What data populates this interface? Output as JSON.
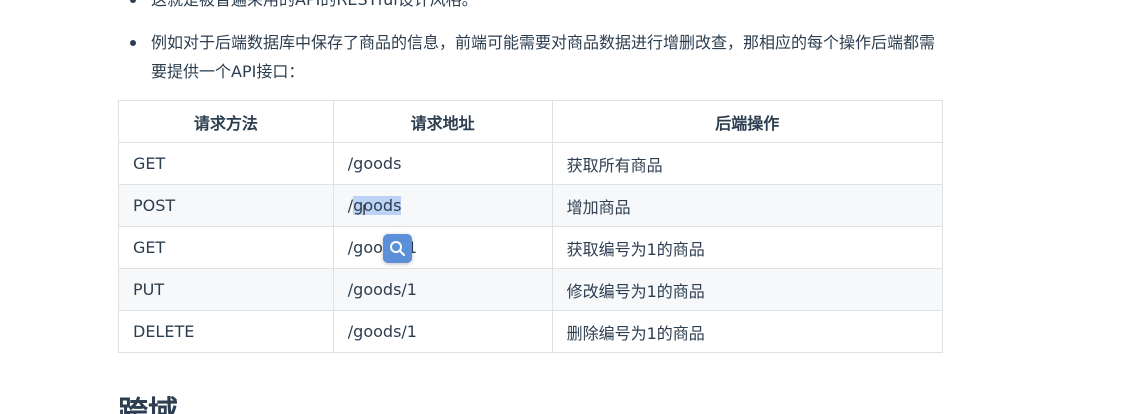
{
  "bullets": [
    "这就是被普遍采用的API的RESTful设计风格。",
    "例如对于后端数据库中保存了商品的信息，前端可能需要对商品数据进行增删改查，那相应的每个操作后端都需要提供一个API接口："
  ],
  "table": {
    "headers": [
      "请求方法",
      "请求地址",
      "后端操作"
    ],
    "rows": [
      [
        "GET",
        "/goods",
        "获取所有商品"
      ],
      [
        "POST",
        "/goods",
        "增加商品"
      ],
      [
        "GET",
        "/goods/1",
        "获取编号为1的商品"
      ],
      [
        "PUT",
        "/goods/1",
        "修改编号为1的商品"
      ],
      [
        "DELETE",
        "/goods/1",
        "删除编号为1的商品"
      ]
    ]
  },
  "selection": {
    "prefix": "/",
    "selected": "goods",
    "row3_prefix": "/goo",
    "row3_suffix": "1"
  },
  "floating_button": {
    "icon": "search-icon"
  },
  "next_heading": "跨域"
}
